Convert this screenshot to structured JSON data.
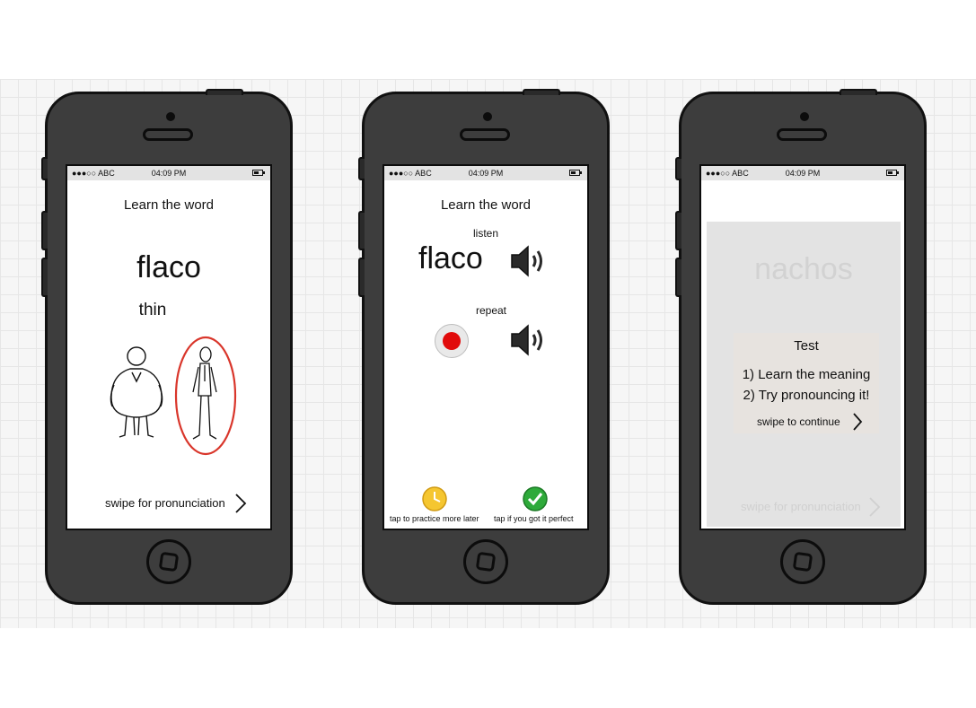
{
  "statusbar": {
    "carrier": "●●●○○ ABC",
    "time": "04:09 PM"
  },
  "phone1": {
    "heading": "Learn the word",
    "word": "flaco",
    "translation": "thin",
    "footer": "swipe for pronunciation",
    "highlight_color": "#d9362b"
  },
  "phone2": {
    "heading": "Learn the word",
    "listen_label": "listen",
    "word": "flaco",
    "repeat_label": "repeat",
    "later_label": "tap to practice more later",
    "perfect_label": "tap if you got it perfect",
    "record_color": "#e10b0b",
    "later_color": "#f5c630",
    "perfect_color": "#2eaa3a"
  },
  "phone3": {
    "faded_word": "nachos",
    "card_title": "Test",
    "step1": "1) Learn the meaning",
    "step2": "2) Try pronouncing it!",
    "continue_label": "swipe to continue",
    "faded_footer": "swipe for pronunciation"
  },
  "icons": [
    "speaker-icon",
    "record-button",
    "clock-icon",
    "checkmark-icon",
    "chevron-right-icon"
  ]
}
